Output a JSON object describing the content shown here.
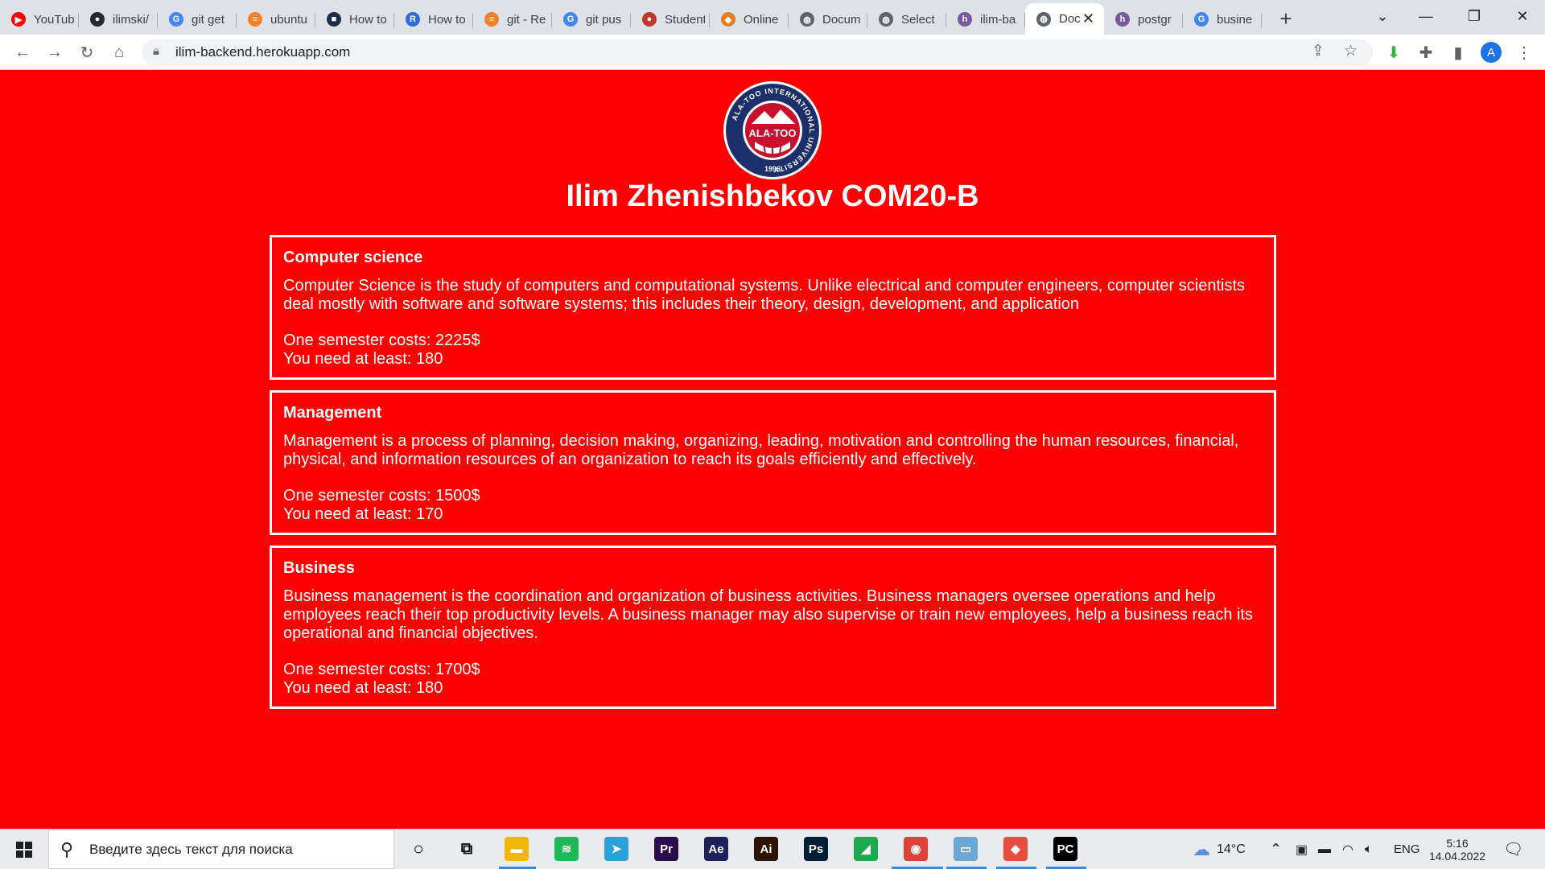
{
  "browser": {
    "tabs": [
      {
        "label": "YouTube",
        "icon": "youtube-icon",
        "color": "#ff0000",
        "glyph": "▶"
      },
      {
        "label": "ilimski/",
        "icon": "github-icon",
        "color": "#24292e",
        "glyph": "●"
      },
      {
        "label": "git get",
        "icon": "google-icon",
        "color": "#4285f4",
        "glyph": "G"
      },
      {
        "label": "ubuntu",
        "icon": "stackoverflow-icon",
        "color": "#f48024",
        "glyph": "≡"
      },
      {
        "label": "How to",
        "icon": "site-icon",
        "color": "#1b2b4b",
        "glyph": "■"
      },
      {
        "label": "How to",
        "icon": "site-icon",
        "color": "#2d6cdf",
        "glyph": "R"
      },
      {
        "label": "git - Re",
        "icon": "stackoverflow-icon",
        "color": "#f48024",
        "glyph": "≡"
      },
      {
        "label": "git pus",
        "icon": "google-icon",
        "color": "#4285f4",
        "glyph": "G"
      },
      {
        "label": "Student",
        "icon": "site-icon",
        "color": "#c0392b",
        "glyph": "●"
      },
      {
        "label": "Online",
        "icon": "site-icon",
        "color": "#e67e22",
        "glyph": "◆"
      },
      {
        "label": "Docum",
        "icon": "globe-icon",
        "color": "#5f6368",
        "glyph": "◍"
      },
      {
        "label": "Select",
        "icon": "globe-icon",
        "color": "#5f6368",
        "glyph": "◍"
      },
      {
        "label": "ilim-ba",
        "icon": "heroku-icon",
        "color": "#79589f",
        "glyph": "h"
      },
      {
        "label": "Doc",
        "icon": "globe-icon",
        "color": "#5f6368",
        "glyph": "◍",
        "active": true
      },
      {
        "label": "postgr",
        "icon": "heroku-icon",
        "color": "#79589f",
        "glyph": "h"
      },
      {
        "label": "busine",
        "icon": "google-icon",
        "color": "#4285f4",
        "glyph": "G"
      }
    ],
    "url": "ilim-backend.herokuapp.com",
    "avatar_letter": "A"
  },
  "page": {
    "logo": {
      "ring_text": "ALA-TOO INTERNATIONAL UNIVERSITY",
      "name": "ALA-TOO",
      "year": "1996"
    },
    "title": "Ilim Zhenishbekov COM20-B",
    "programs": [
      {
        "name": "Computer science",
        "description": "Computer Science is the study of computers and computational systems. Unlike electrical and computer engineers, computer scientists deal mostly with software and software systems; this includes their theory, design, development, and application",
        "cost_line": "One semester costs: 2225$",
        "min_line": "You need at least: 180"
      },
      {
        "name": "Management",
        "description": "Management is a process of planning, decision making, organizing, leading, motivation and controlling the human resources, financial, physical, and information resources of an organization to reach its goals efficiently and effectively.",
        "cost_line": "One semester costs: 1500$",
        "min_line": "You need at least: 170"
      },
      {
        "name": "Business",
        "description": "Business management is the coordination and organization of business activities. Business managers oversee operations and help employees reach their top productivity levels. A business manager may also supervise or train new employees, help a business reach its operational and financial objectives.",
        "cost_line": "One semester costs: 1700$",
        "min_line": "You need at least: 180"
      }
    ]
  },
  "taskbar": {
    "search_placeholder": "Введите здесь текст для поиска",
    "weather": "14°C",
    "language": "ENG",
    "time": "5:16",
    "date": "14.04.2022",
    "apps": [
      {
        "name": "file-explorer-icon",
        "glyph": "▬",
        "color": "#f2b705"
      },
      {
        "name": "spotify-icon",
        "glyph": "≋",
        "color": "#1db954"
      },
      {
        "name": "telegram-icon",
        "glyph": "➤",
        "color": "#2aa1da"
      },
      {
        "name": "premiere-icon",
        "glyph": "Pr",
        "color": "#2a0a4a"
      },
      {
        "name": "after-effects-icon",
        "glyph": "Ae",
        "color": "#1f1f5c"
      },
      {
        "name": "illustrator-icon",
        "glyph": "Ai",
        "color": "#2e1300"
      },
      {
        "name": "photoshop-icon",
        "glyph": "Ps",
        "color": "#001e36"
      },
      {
        "name": "green-app-icon",
        "glyph": "◢",
        "color": "#1ea94f"
      },
      {
        "name": "chrome-icon",
        "glyph": "◉",
        "color": "#db4437"
      },
      {
        "name": "notes-app-icon",
        "glyph": "▭",
        "color": "#6aa9d6"
      },
      {
        "name": "colorful-app-icon",
        "glyph": "◆",
        "color": "#e84c3d"
      },
      {
        "name": "pycharm-icon",
        "glyph": "PC",
        "color": "#000000"
      }
    ]
  }
}
